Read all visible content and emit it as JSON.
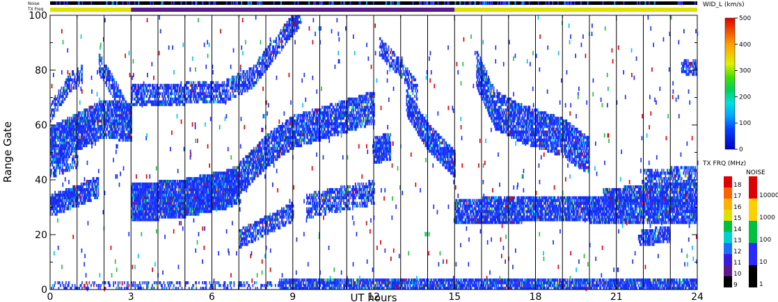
{
  "chart_data": {
    "type": "heatmap",
    "xlabel": "UT hours",
    "ylabel": "Range Gate",
    "xlim": [
      0,
      24
    ],
    "ylim": [
      0,
      100
    ],
    "xticks": [
      "0",
      "3",
      "6",
      "9",
      "12",
      "15",
      "18",
      "21",
      "24"
    ],
    "yticks": [
      "0",
      "20",
      "40",
      "60",
      "80",
      "100"
    ],
    "top_bars": {
      "noise_label": "Noise",
      "freq_label": "TX Freq"
    },
    "velocity_scale": {
      "title": "WID_L (km/s)",
      "range": [
        0,
        500
      ],
      "ticks": [
        "0",
        "100",
        "200",
        "300",
        "400",
        "500"
      ]
    },
    "freq_scale": {
      "title": "TX FRQ (MHz)",
      "ticks": [
        "9",
        "10",
        "11",
        "12",
        "13",
        "14",
        "15",
        "16",
        "17",
        "18"
      ],
      "colors": [
        "#000000",
        "#5a1a8a",
        "#3a1ae0",
        "#1a6fff",
        "#00d0d0",
        "#00c040",
        "#e0e000",
        "#ffb000",
        "#ff6000",
        "#e00000"
      ]
    },
    "noise_scale": {
      "title": "NOISE",
      "ticks": [
        "1",
        "10",
        "100",
        "1000",
        "10000"
      ],
      "colors": [
        "#000000",
        "#2a2aff",
        "#00c040",
        "#ffd000",
        "#e00000"
      ]
    },
    "tx_freq_segments": [
      {
        "start": 0,
        "end": 3,
        "value": 15
      },
      {
        "start": 3,
        "end": 15,
        "value": 10
      },
      {
        "start": 15,
        "end": 24,
        "value": 15
      }
    ],
    "scatter_bands": [
      {
        "times": [
          0,
          1,
          2,
          3
        ],
        "gates": [
          52,
          57,
          62,
          60
        ],
        "width": 12,
        "density": 0.85
      },
      {
        "times": [
          0,
          0.7,
          1.2
        ],
        "gates": [
          64,
          75,
          78
        ],
        "width": 5,
        "density": 0.6
      },
      {
        "times": [
          1.8,
          2.5,
          3
        ],
        "gates": [
          82,
          70,
          60
        ],
        "width": 6,
        "density": 0.7
      },
      {
        "times": [
          0,
          0.8,
          1.8
        ],
        "gates": [
          30,
          33,
          37
        ],
        "width": 6,
        "density": 0.85
      },
      {
        "times": [
          0,
          1
        ],
        "gates": [
          43,
          47
        ],
        "width": 4,
        "density": 0.6
      },
      {
        "times": [
          3,
          5,
          6.5,
          7
        ],
        "gates": [
          31,
          33,
          36,
          38
        ],
        "width": 12,
        "density": 0.95
      },
      {
        "times": [
          3,
          5,
          6.5,
          7.5,
          8.5,
          9.3
        ],
        "gates": [
          70,
          71,
          72,
          77,
          90,
          100
        ],
        "width": 6,
        "density": 0.7
      },
      {
        "times": [
          7,
          8,
          9,
          10,
          11,
          12
        ],
        "gates": [
          40,
          50,
          57,
          60,
          63,
          66
        ],
        "width": 10,
        "density": 0.8
      },
      {
        "times": [
          7,
          8,
          9
        ],
        "gates": [
          18,
          23,
          28
        ],
        "width": 5,
        "density": 0.7
      },
      {
        "times": [
          9.5,
          11,
          12
        ],
        "gates": [
          30,
          33,
          35
        ],
        "width": 7,
        "density": 0.6
      },
      {
        "times": [
          12,
          12.6
        ],
        "gates": [
          50,
          52
        ],
        "width": 8,
        "density": 0.85
      },
      {
        "times": [
          12.2,
          13,
          13.6
        ],
        "gates": [
          88,
          80,
          72
        ],
        "width": 5,
        "density": 0.6
      },
      {
        "times": [
          13.2,
          14,
          15
        ],
        "gates": [
          68,
          55,
          45
        ],
        "width": 8,
        "density": 0.85
      },
      {
        "times": [
          15,
          16,
          17.5,
          19,
          20,
          24
        ],
        "gates": [
          28,
          28,
          29,
          29,
          29,
          28
        ],
        "width": 8,
        "density": 0.85
      },
      {
        "times": [
          15.8,
          16.5,
          17.5,
          19,
          20
        ],
        "gates": [
          80,
          65,
          60,
          55,
          48
        ],
        "width": 12,
        "density": 0.8
      },
      {
        "times": [
          20.5,
          22,
          24
        ],
        "gates": [
          33,
          34,
          35
        ],
        "width": 5,
        "density": 0.8
      },
      {
        "times": [
          22,
          24
        ],
        "gates": [
          40,
          41
        ],
        "width": 5,
        "density": 0.6
      },
      {
        "times": [
          21.8,
          23
        ],
        "gates": [
          18,
          20
        ],
        "width": 4,
        "density": 0.7
      },
      {
        "times": [
          23.4,
          24
        ],
        "gates": [
          81,
          80
        ],
        "width": 4,
        "density": 0.7
      },
      {
        "times": [
          8.5,
          24
        ],
        "gates": [
          1,
          1
        ],
        "width": 3,
        "density": 0.85
      },
      {
        "times": [
          0,
          8.5
        ],
        "gates": [
          1,
          1
        ],
        "width": 2,
        "density": 0.35
      }
    ]
  }
}
